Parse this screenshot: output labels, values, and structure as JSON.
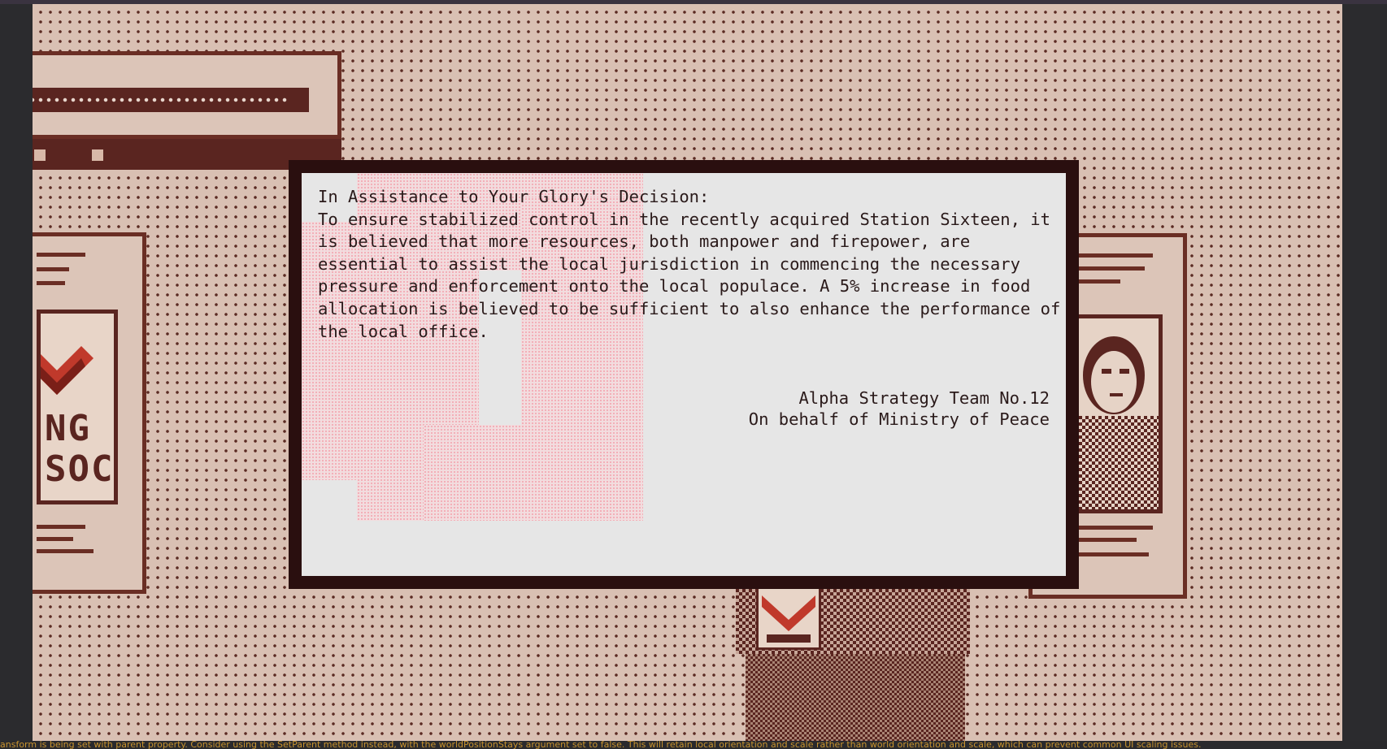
{
  "dialog": {
    "heading": "In Assistance to Your Glory's Decision:",
    "body": "To ensure stabilized control in the recently acquired Station Sixteen, it is believed that more resources, both manpower and firepower, are essential to assist the local jurisdiction in commencing the necessary pressure and enforcement onto the local populace. A 5% increase in food allocation is believed to be sufficient to also enhance the performance of the local office.",
    "signature_line1": "Alpha Strategy Team No.12",
    "signature_line2": "On behalf of Ministry of Peace"
  },
  "poster_left": {
    "text_line1": "NG",
    "text_line2": "SOC"
  },
  "console": {
    "message": "ansform is being set with parent property. Consider using the SetParent method instead, with the worldPositionStays argument set to false. This will retain local orientation and scale rather than world orientation and scale, which can prevent common UI scaling issues."
  },
  "colors": {
    "background": "#d9c0b3",
    "dots": "#5a2a22",
    "dialog_border": "#2a0f0f",
    "dialog_bg": "#e6e6e6",
    "accent_red": "#c0392b"
  },
  "icons": [
    "chevron-emblem-icon",
    "portrait-icon",
    "chevron-badge-icon"
  ]
}
